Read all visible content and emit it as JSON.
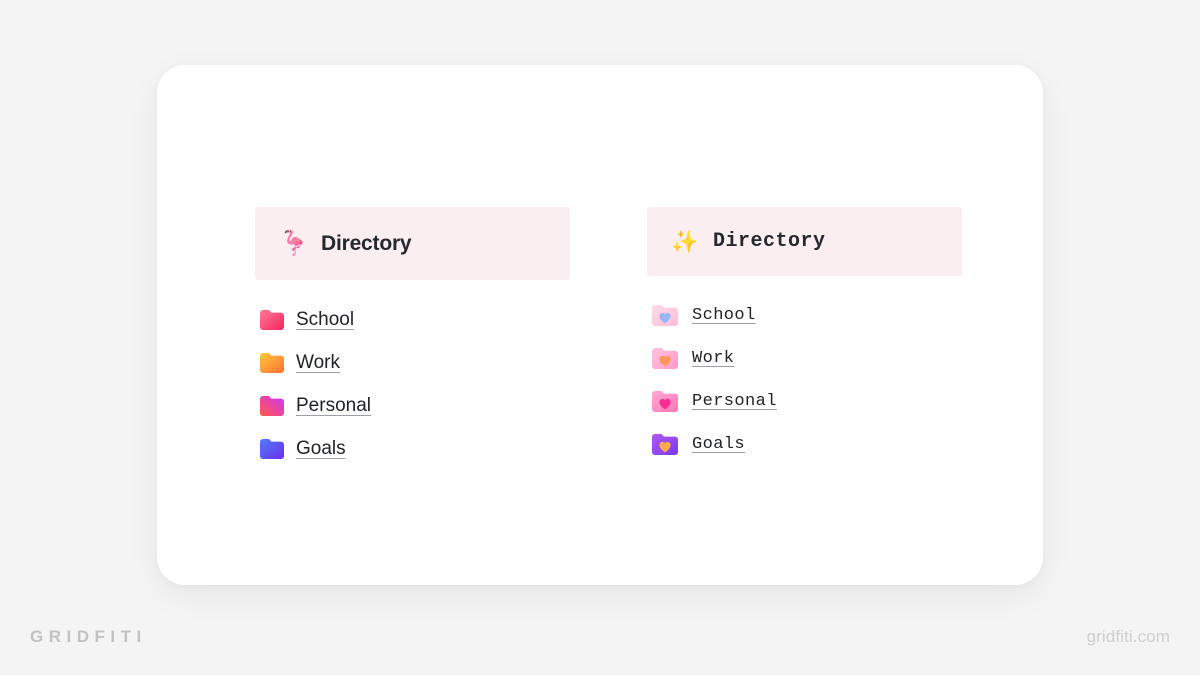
{
  "card": {
    "panels": [
      {
        "id": "panel-classic",
        "header": {
          "emoji": "🦩",
          "emoji_name": "flamingo-emoji",
          "title": "Directory",
          "background": "#fbeef0"
        },
        "items": [
          {
            "icon_name": "folder-icon-pink",
            "label": "School",
            "colors": [
              "#ff4d6d",
              "#ff8fa8"
            ]
          },
          {
            "icon_name": "folder-icon-orange",
            "label": "Work",
            "colors": [
              "#ffb020",
              "#ff7a3d"
            ]
          },
          {
            "icon_name": "folder-icon-magenta",
            "label": "Personal",
            "colors": [
              "#ff4d4d",
              "#d633ff"
            ]
          },
          {
            "icon_name": "folder-icon-blue",
            "label": "Goals",
            "colors": [
              "#5b6ef5",
              "#6d3bf0"
            ]
          }
        ]
      },
      {
        "id": "panel-mono",
        "header": {
          "emoji": "✨",
          "emoji_name": "sparkles-emoji",
          "title": "Directory",
          "background": "#fbeef0"
        },
        "items": [
          {
            "icon_name": "heart-folder-icon-blush",
            "label": "School",
            "colors": [
              "#ffd3e2",
              "#ffc0d4"
            ],
            "heart": "#9fb8f0"
          },
          {
            "icon_name": "heart-folder-icon-pink",
            "label": "Work",
            "colors": [
              "#ffb8d9",
              "#ff9ec8"
            ],
            "heart": "#ff9a5c"
          },
          {
            "icon_name": "heart-folder-icon-rose",
            "label": "Personal",
            "colors": [
              "#ff9ecd",
              "#ff7ab8"
            ],
            "heart": "#ff2e93"
          },
          {
            "icon_name": "heart-folder-icon-purple",
            "label": "Goals",
            "colors": [
              "#a855f7",
              "#7c3aed"
            ],
            "heart": "#ffa94d"
          }
        ]
      }
    ]
  },
  "footer": {
    "brand": "GRIDFITI",
    "website": "gridfiti.com"
  }
}
